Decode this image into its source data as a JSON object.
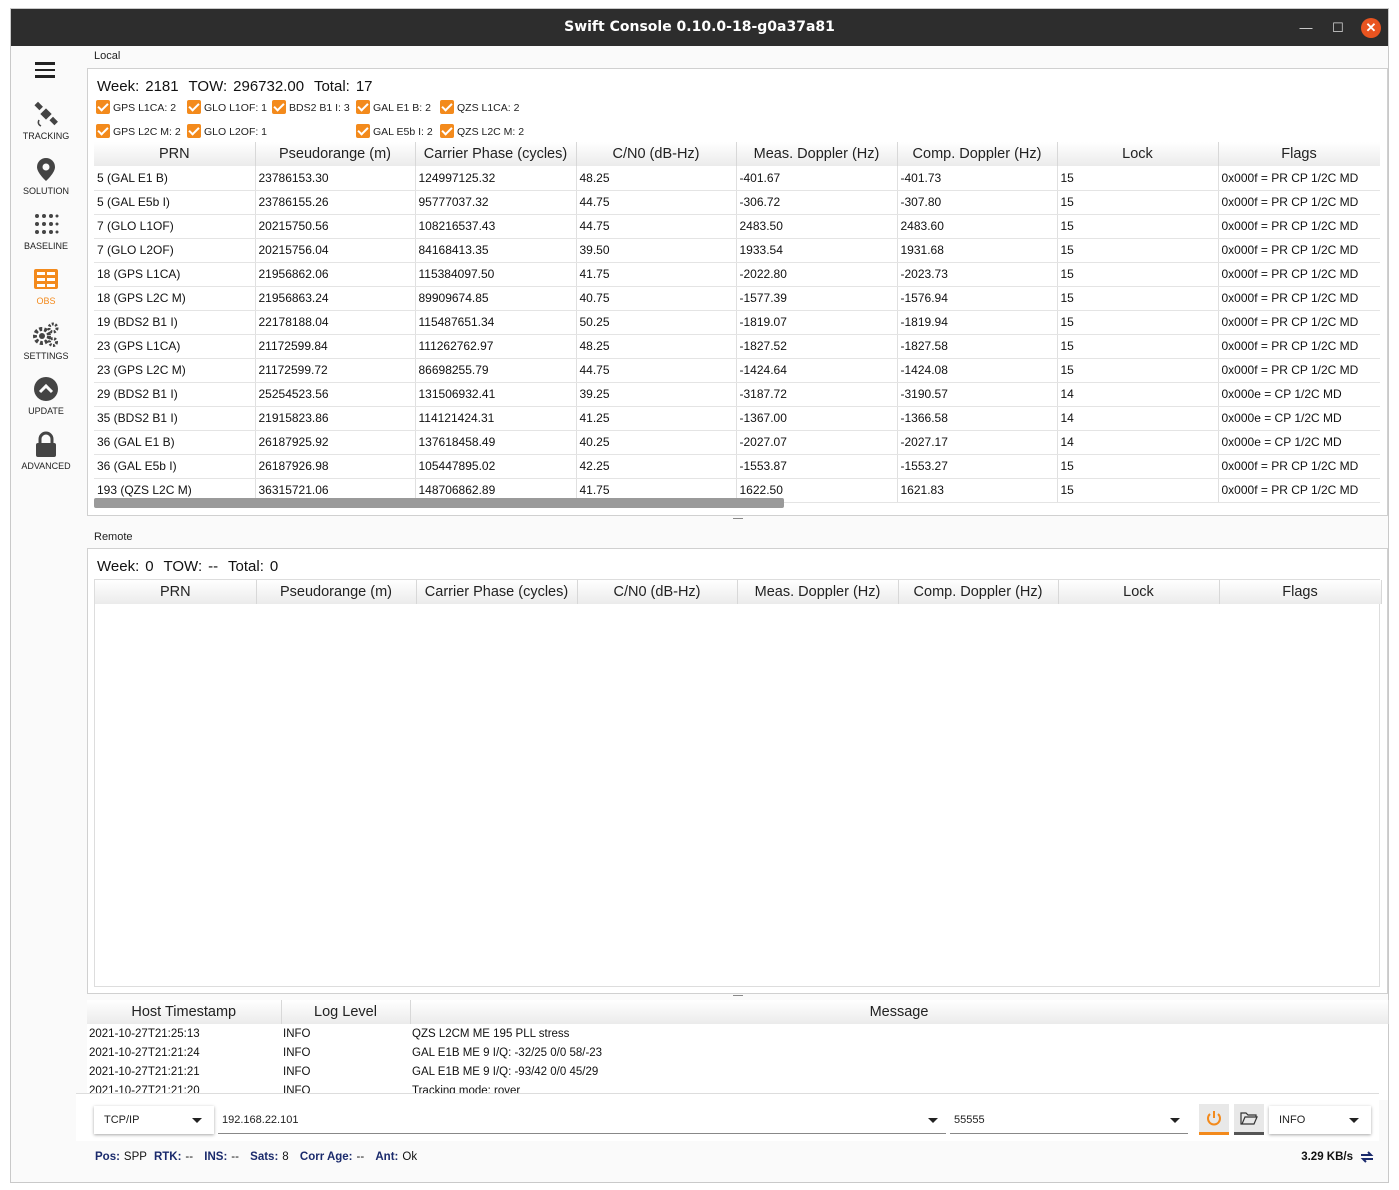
{
  "window": {
    "title": "Swift Console 0.10.0-18-g0a37a81"
  },
  "sidebar": {
    "items": [
      {
        "label": "TRACKING",
        "icon": "satellite-icon"
      },
      {
        "label": "SOLUTION",
        "icon": "location-pin-icon"
      },
      {
        "label": "BASELINE",
        "icon": "dots-grid-icon"
      },
      {
        "label": "OBS",
        "icon": "table-icon",
        "active": true
      },
      {
        "label": "SETTINGS",
        "icon": "gears-icon"
      },
      {
        "label": "UPDATE",
        "icon": "chevron-up-circle-icon"
      },
      {
        "label": "ADVANCED",
        "icon": "lock-icon"
      }
    ]
  },
  "local": {
    "panel_label": "Local",
    "week_label": "Week:",
    "week": "2181",
    "tow_label": "TOW:",
    "tow": "296732.00",
    "total_label": "Total:",
    "total": "17",
    "filters": [
      "GPS L1CA: 2",
      "GLO L1OF: 1",
      "BDS2 B1 I: 3",
      "GAL E1 B: 2",
      "QZS L1CA: 2",
      "GPS L2C M: 2",
      "GLO L2OF: 1",
      "GAL E5b I: 2",
      "QZS L2C M: 2"
    ],
    "columns": [
      "PRN",
      "Pseudorange (m)",
      "Carrier Phase (cycles)",
      "C/N0 (dB-Hz)",
      "Meas. Doppler (Hz)",
      "Comp. Doppler (Hz)",
      "Lock",
      "Flags"
    ],
    "rows": [
      [
        "5 (GAL E1 B)",
        "23786153.30",
        "124997125.32",
        "48.25",
        "-401.67",
        "-401.73",
        "15",
        "0x000f = PR CP 1/2C MD"
      ],
      [
        "5 (GAL E5b I)",
        "23786155.26",
        "95777037.32",
        "44.75",
        "-306.72",
        "-307.80",
        "15",
        "0x000f = PR CP 1/2C MD"
      ],
      [
        "7 (GLO L1OF)",
        "20215750.56",
        "108216537.43",
        "44.75",
        "2483.50",
        "2483.60",
        "15",
        "0x000f = PR CP 1/2C MD"
      ],
      [
        "7 (GLO L2OF)",
        "20215756.04",
        "84168413.35",
        "39.50",
        "1933.54",
        "1931.68",
        "15",
        "0x000f = PR CP 1/2C MD"
      ],
      [
        "18 (GPS L1CA)",
        "21956862.06",
        "115384097.50",
        "41.75",
        "-2022.80",
        "-2023.73",
        "15",
        "0x000f = PR CP 1/2C MD"
      ],
      [
        "18 (GPS L2C M)",
        "21956863.24",
        "89909674.85",
        "40.75",
        "-1577.39",
        "-1576.94",
        "15",
        "0x000f = PR CP 1/2C MD"
      ],
      [
        "19 (BDS2 B1 I)",
        "22178188.04",
        "115487651.34",
        "50.25",
        "-1819.07",
        "-1819.94",
        "15",
        "0x000f = PR CP 1/2C MD"
      ],
      [
        "23 (GPS L1CA)",
        "21172599.84",
        "111262762.97",
        "48.25",
        "-1827.52",
        "-1827.58",
        "15",
        "0x000f = PR CP 1/2C MD"
      ],
      [
        "23 (GPS L2C M)",
        "21172599.72",
        "86698255.79",
        "44.75",
        "-1424.64",
        "-1424.08",
        "15",
        "0x000f = PR CP 1/2C MD"
      ],
      [
        "29 (BDS2 B1 I)",
        "25254523.56",
        "131506932.41",
        "39.25",
        "-3187.72",
        "-3190.57",
        "14",
        "0x000e = CP 1/2C MD"
      ],
      [
        "35 (BDS2 B1 I)",
        "21915823.86",
        "114121424.31",
        "41.25",
        "-1367.00",
        "-1366.58",
        "14",
        "0x000e = CP 1/2C MD"
      ],
      [
        "36 (GAL E1 B)",
        "26187925.92",
        "137618458.49",
        "40.25",
        "-2027.07",
        "-2027.17",
        "14",
        "0x000e = CP 1/2C MD"
      ],
      [
        "36 (GAL E5b I)",
        "26187926.98",
        "105447895.02",
        "42.25",
        "-1553.87",
        "-1553.27",
        "15",
        "0x000f = PR CP 1/2C MD"
      ],
      [
        "193 (QZS L2C M)",
        "36315721.06",
        "148706862.89",
        "41.75",
        "1622.50",
        "1621.83",
        "15",
        "0x000f = PR CP 1/2C MD"
      ]
    ]
  },
  "remote": {
    "panel_label": "Remote",
    "week_label": "Week:",
    "week": "0",
    "tow_label": "TOW:",
    "tow": "--",
    "total_label": "Total:",
    "total": "0",
    "columns": [
      "PRN",
      "Pseudorange (m)",
      "Carrier Phase (cycles)",
      "C/N0 (dB-Hz)",
      "Meas. Doppler (Hz)",
      "Comp. Doppler (Hz)",
      "Lock",
      "Flags"
    ]
  },
  "log": {
    "columns": [
      "Host Timestamp",
      "Log Level",
      "Message"
    ],
    "rows": [
      [
        "2021-10-27T21:25:13",
        "INFO",
        "QZS L2CM ME 195 PLL stress"
      ],
      [
        "2021-10-27T21:21:24",
        "INFO",
        "GAL E1B ME 9 I/Q: -32/25 0/0 58/-23"
      ],
      [
        "2021-10-27T21:21:21",
        "INFO",
        "GAL E1B ME 9 I/Q: -93/42 0/0 45/29"
      ],
      [
        "2021-10-27T21:21:20",
        "INFO",
        "Tracking mode: rover"
      ]
    ]
  },
  "connection": {
    "type": "TCP/IP",
    "host": "192.168.22.101",
    "port": "55555",
    "log_level": "INFO"
  },
  "status": {
    "pos_label": "Pos:",
    "pos": "SPP",
    "rtk_label": "RTK:",
    "rtk": "--",
    "ins_label": "INS:",
    "ins": "--",
    "sats_label": "Sats:",
    "sats": "8",
    "corr_label": "Corr Age:",
    "corr": "--",
    "ant_label": "Ant:",
    "ant": "Ok",
    "rate": "3.29 KB/s"
  },
  "colors": {
    "accent": "#f38a1c",
    "titlebar": "#2d2d2d",
    "close": "#e95420",
    "status_key": "#1a2a6c"
  }
}
